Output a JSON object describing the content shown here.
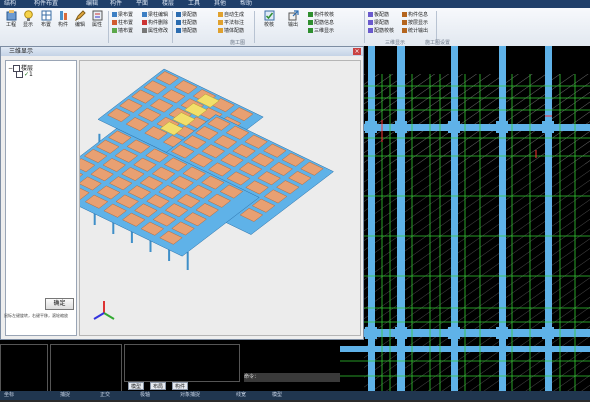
{
  "menu": [
    "结构",
    "构件布置",
    "编辑",
    "构件",
    "平面",
    "楼层",
    "工具",
    "其他",
    "帮助"
  ],
  "ribbon": {
    "big_buttons": [
      {
        "label": "工程",
        "icon": "project-icon"
      },
      {
        "label": "显示",
        "icon": "bulb-icon"
      },
      {
        "label": "布置",
        "icon": "layout-icon"
      },
      {
        "label": "构件",
        "icon": "component-icon"
      },
      {
        "label": "编辑",
        "icon": "edit-icon"
      },
      {
        "label": "属性",
        "icon": "properties-icon"
      }
    ],
    "small_items": [
      "梁布置",
      "柱布置",
      "墙布置",
      "梁柱编辑",
      "构件删除",
      "属性修改",
      "梁配筋",
      "柱配筋",
      "墙配筋",
      "自动生成",
      "平法标注",
      "墙体配筋",
      "构件校核",
      "配筋信息",
      "三维显示",
      "板配筋",
      "梁配筋",
      "配筋校核",
      "构件信息",
      "按层显示",
      "统计输出"
    ],
    "big_buttons_right": [
      {
        "label": "校核",
        "icon": "check-icon"
      },
      {
        "label": "输出",
        "icon": "export-icon"
      }
    ],
    "groups": [
      "施工图",
      "三维显示",
      "施工图设置"
    ]
  },
  "dialog": {
    "title": "三维显示",
    "tree_root": "楼层",
    "tree_child": "1",
    "ok_label": "确定",
    "note": "鼠标左键旋转，右键平移，滚轮缩放"
  },
  "command": {
    "prompt": "命令："
  },
  "tabs": [
    "模型",
    "布局",
    "构件"
  ],
  "statusbar": [
    "坐标",
    "捕捉",
    "正交",
    "极轴",
    "对象捕捉",
    "线宽",
    "模型"
  ],
  "colors": {
    "grid_line": "#33cc33",
    "beam": "#5fb2e8",
    "slab": "#e8a072",
    "highlight_slab": "#f2df6a"
  }
}
